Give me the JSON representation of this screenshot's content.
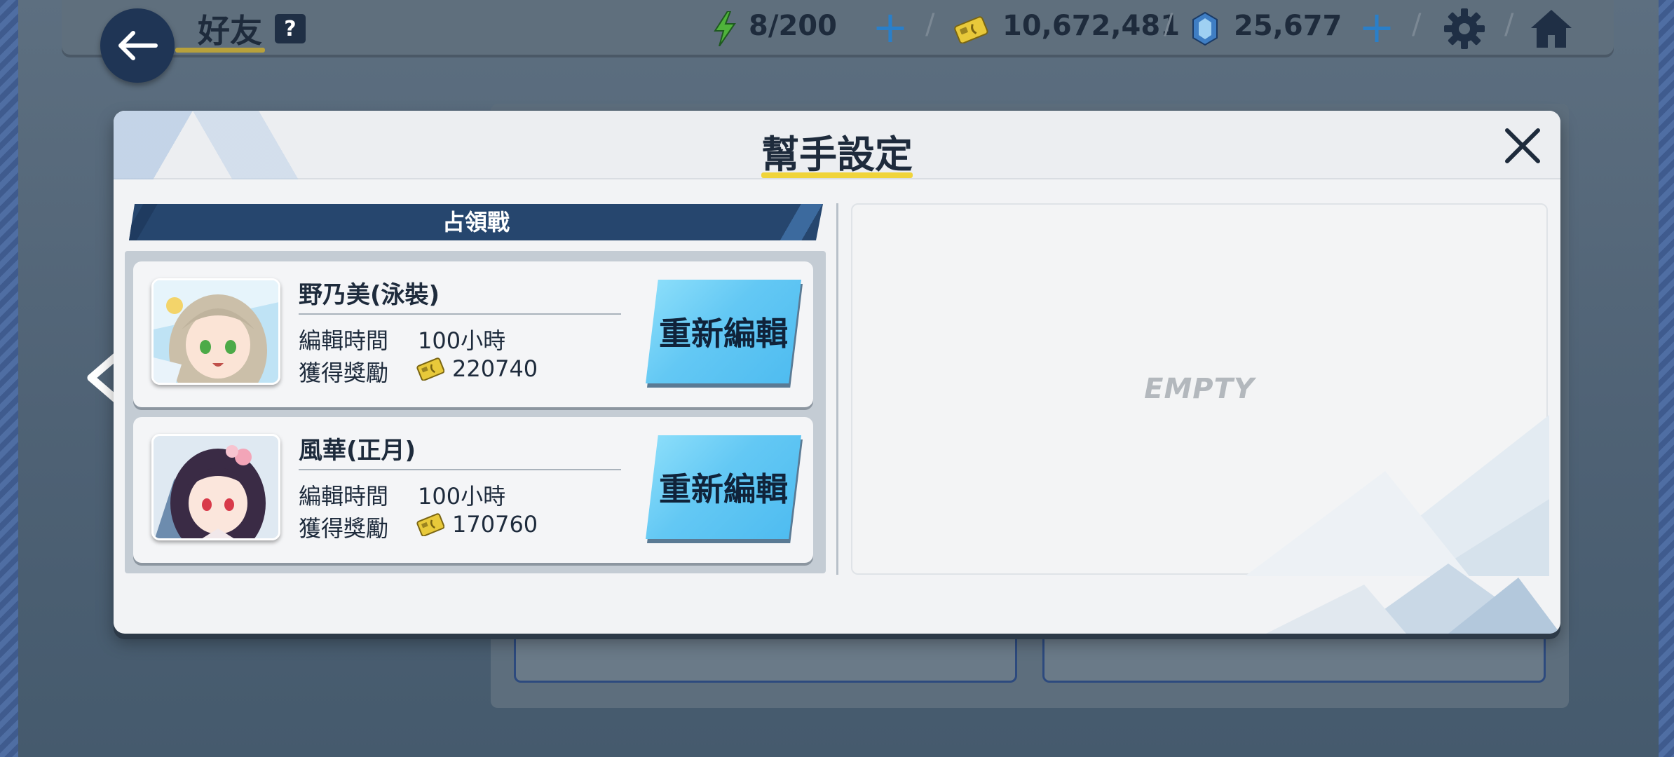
{
  "header": {
    "title": "好友",
    "help_badge": "?",
    "stamina": "8/200",
    "credits": "10,672,481",
    "gems": "25,677"
  },
  "modal": {
    "title": "幫手設定",
    "section_label": "占領戰",
    "empty_text": "EMPTY",
    "helpers": [
      {
        "name": "野乃美(泳裝)",
        "edit_time_label": "編輯時間",
        "edit_time_value": "100小時",
        "reward_label": "獲得獎勵",
        "reward_value": "220740",
        "button_label": "重新編輯"
      },
      {
        "name": "風華(正月)",
        "edit_time_label": "編輯時間",
        "edit_time_value": "100小時",
        "reward_label": "獲得獎勵",
        "reward_value": "170760",
        "button_label": "重新編輯"
      }
    ]
  },
  "icons": {
    "back": "back-arrow-icon",
    "stamina": "lightning-icon",
    "credits": "credit-card-icon",
    "gems": "gem-icon",
    "settings": "gear-icon",
    "home": "home-icon",
    "close": "close-icon",
    "prev": "chevron-left-icon"
  },
  "colors": {
    "accent_underline": "#f0d43a",
    "button_blue": "#63c8f4",
    "ribbon": "#26466e",
    "plus": "#2a7fc9"
  }
}
